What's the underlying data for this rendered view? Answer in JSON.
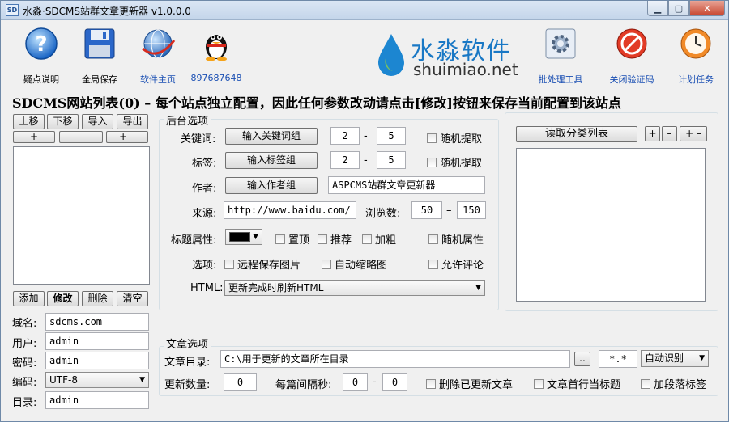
{
  "window": {
    "title": "水淼·SDCMS站群文章更新器 v1.0.0.0",
    "icon_text": "SD"
  },
  "toolbar": {
    "items": [
      {
        "label": "疑点说明",
        "icon": "help-icon"
      },
      {
        "label": "全局保存",
        "icon": "floppy-save-icon"
      },
      {
        "label": "软件主页",
        "icon": "globe-icon"
      },
      {
        "label": "897687648",
        "icon": "qq-penguin-icon"
      },
      {
        "label": "批处理工具",
        "icon": "gear-tool-icon"
      },
      {
        "label": "关闭验证码",
        "icon": "stop-sign-icon"
      },
      {
        "label": "计划任务",
        "icon": "clock-icon"
      }
    ],
    "logo_cn": "水淼软件",
    "logo_en": "shuimiao.net"
  },
  "header": {
    "text": "SDCMS网站列表(0) – 每个站点独立配置，因此任何参数改动请点击[修改]按钮来保存当前配置到该站点"
  },
  "left": {
    "move_buttons": [
      "上移",
      "下移",
      "导入",
      "导出"
    ],
    "small_buttons": [
      "+",
      "–",
      "+ –"
    ],
    "action_buttons": [
      "添加",
      "修改",
      "删除",
      "清空"
    ],
    "fields": [
      {
        "label": "域名:",
        "value": "sdcms.com"
      },
      {
        "label": "用户:",
        "value": "admin"
      },
      {
        "label": "密码:",
        "value": "admin"
      },
      {
        "label": "编码:",
        "value": "UTF-8"
      },
      {
        "label": "目录:",
        "value": "admin"
      }
    ]
  },
  "backend": {
    "title": "后台选项",
    "keyword": {
      "label": "关键词:",
      "button": "输入关键词组",
      "min": "2",
      "dash": "-",
      "max": "5",
      "random": "随机提取"
    },
    "tags": {
      "label": "标签:",
      "button": "输入标签组",
      "min": "2",
      "dash": "-",
      "max": "5",
      "random": "随机提取"
    },
    "author": {
      "label": "作者:",
      "button": "输入作者组",
      "value": "ASPCMS站群文章更新器"
    },
    "source": {
      "label": "来源:",
      "value": "http://www.baidu.com/",
      "views_label": "浏览数:",
      "views_min": "50",
      "dash": "–",
      "views_max": "150"
    },
    "title_attr": {
      "label": "标题属性:",
      "color": "#000000",
      "top": "置顶",
      "recommend": "推荐",
      "bold": "加粗",
      "random": "随机属性"
    },
    "options": {
      "label": "选项:",
      "remote_img": "远程保存图片",
      "auto_thumb": "自动缩略图",
      "allow_comment": "允许评论"
    },
    "html": {
      "label": "HTML:",
      "value": "更新完成时刷新HTML"
    }
  },
  "category": {
    "read_button": "读取分类列表",
    "buttons": [
      "+",
      "–",
      "+ –"
    ]
  },
  "article": {
    "title": "文章选项",
    "dir_label": "文章目录:",
    "dir_value": "C:\\用于更新的文章所在目录",
    "browse": "..",
    "ext": "*.*",
    "encoding": "自动识别",
    "count_label": "更新数量:",
    "count_value": "0",
    "interval_label": "每篇间隔秒:",
    "interval_min": "0",
    "dash": "-",
    "interval_max": "0",
    "delete_updated": "删除已更新文章",
    "first_line_title": "文章首行当标题",
    "add_para": "加段落标签"
  }
}
